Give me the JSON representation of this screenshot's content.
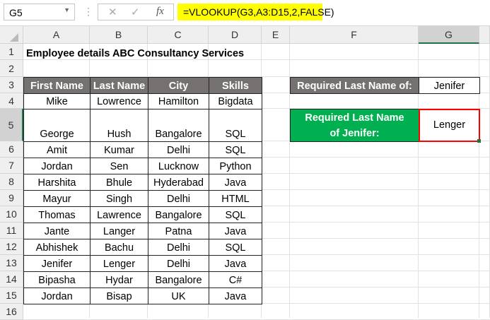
{
  "formula_bar": {
    "name_box": "G5",
    "cancel": "✕",
    "enter": "✓",
    "fx": "fx",
    "formula": "=VLOOKUP(G3,A3:D15,2,FALSE)"
  },
  "columns": [
    "A",
    "B",
    "C",
    "D",
    "E",
    "F",
    "G"
  ],
  "rows": [
    "1",
    "2",
    "3",
    "4",
    "5",
    "6",
    "7",
    "8",
    "9",
    "10",
    "11",
    "12",
    "13",
    "14",
    "15",
    "16"
  ],
  "title": "Employee details ABC Consultancy Services",
  "table": {
    "headers": [
      "First Name",
      "Last Name",
      "City",
      "Skills"
    ],
    "rows": [
      [
        "Mike",
        "Lowrence",
        "Hamilton",
        "Bigdata"
      ],
      [
        "George",
        "Hush",
        "Bangalore",
        "SQL"
      ],
      [
        "Amit",
        "Kumar",
        "Delhi",
        "SQL"
      ],
      [
        "Jordan",
        "Sen",
        "Lucknow",
        "Python"
      ],
      [
        "Harshita",
        "Bhule",
        "Hyderabad",
        "Java"
      ],
      [
        "Mayur",
        "Singh",
        "Delhi",
        "HTML"
      ],
      [
        "Thomas",
        "Lawrence",
        "Bangalore",
        "SQL"
      ],
      [
        "Jante",
        "Langer",
        "Patna",
        "Java"
      ],
      [
        "Abhishek",
        "Bachu",
        "Delhi",
        "SQL"
      ],
      [
        "Jenifer",
        "Lenger",
        "Delhi",
        "Java"
      ],
      [
        "Bipasha",
        "Hydar",
        "Bangalore",
        "C#"
      ],
      [
        "Jordan",
        "Bisap",
        "UK",
        "Java"
      ]
    ]
  },
  "lookup": {
    "label1": "Required Last Name of:",
    "value1": "Jenifer",
    "label2": "Required Last Name of Jenifer:",
    "result": "Lenger"
  },
  "colors": {
    "header_gray": "#767171",
    "green": "#00b050",
    "selection": "#ff0000",
    "formula_highlight": "#ffff00"
  }
}
